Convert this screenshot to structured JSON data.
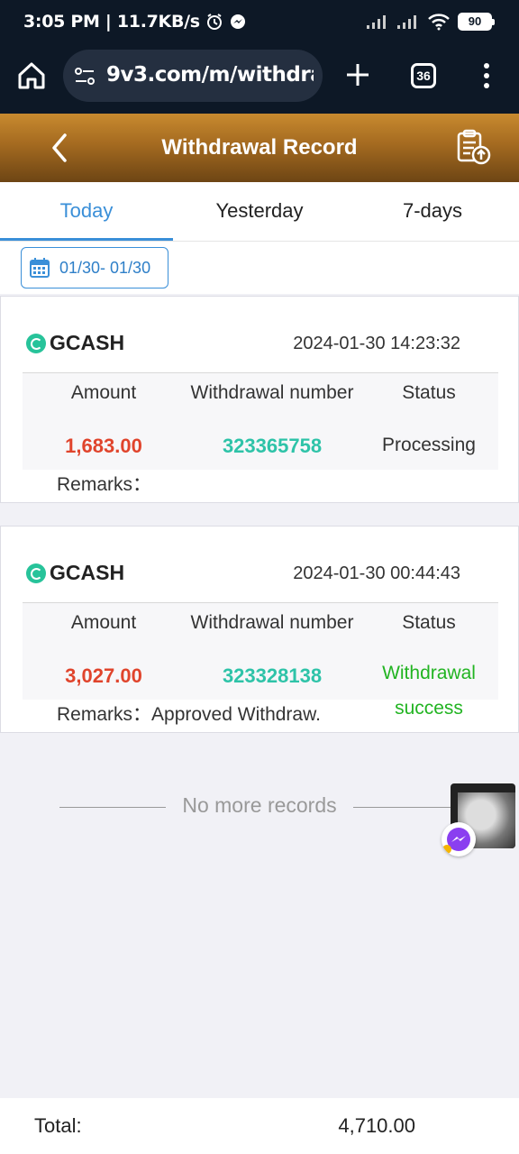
{
  "status_bar": {
    "time_speed": "3:05 PM | 11.7KB/s",
    "battery": "90"
  },
  "browser": {
    "url": "9v3.com/m/withdrawal",
    "tab_count": "36"
  },
  "header": {
    "title": "Withdrawal Record"
  },
  "tabs": [
    {
      "label": "Today",
      "active": true
    },
    {
      "label": "Yesterday",
      "active": false
    },
    {
      "label": "7-days",
      "active": false
    }
  ],
  "date_filter": {
    "range": "01/30- 01/30"
  },
  "columns": {
    "amount": "Amount",
    "number": "Withdrawal number",
    "status": "Status"
  },
  "records": [
    {
      "method": "GCASH",
      "time": "2024-01-30 14:23:32",
      "amount": "1,683.00",
      "number": "323365758",
      "status": "Processing",
      "remarks_label": "Remarks：",
      "remarks": ""
    },
    {
      "method": "GCASH",
      "time": "2024-01-30 00:44:43",
      "amount": "3,027.00",
      "number": "323328138",
      "status": "Withdrawal success",
      "remarks_label": "Remarks：",
      "remarks": "Approved Withdraw."
    }
  ],
  "no_more": "No more records",
  "footer": {
    "total_label": "Total:",
    "total_value": "4,710.00"
  },
  "colors": {
    "accent": "#3a8fd8",
    "amount": "#e0442c",
    "number": "#2ec3a8",
    "success": "#22b422",
    "header_gold": "#a46a20"
  }
}
